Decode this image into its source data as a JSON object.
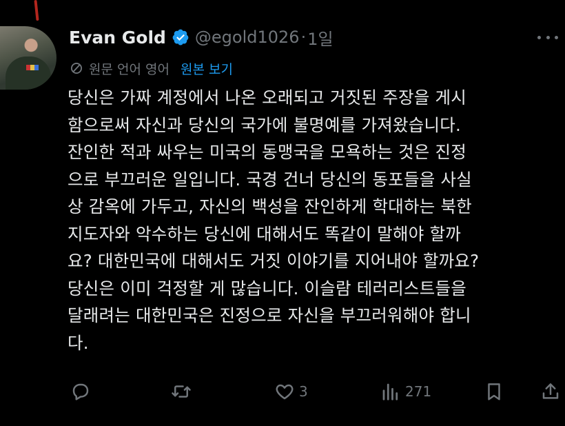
{
  "tweet": {
    "author_name": "Evan Gold",
    "handle": "@egold1026",
    "separator": "·",
    "time": "1일",
    "translated_from": "원문 언어 영어",
    "show_original": "원본 보기",
    "body_lines": [
      "당신은 가짜 계정에서 나온 오래되고 거짓된 주장을 게시",
      "함으로써 자신과 당신의 국가에 불명예를 가져왔습니다.",
      "잔인한 적과 싸우는 미국의 동맹국을 모욕하는 것은 진정",
      "으로 부끄러운 일입니다. 국경 건너 당신의 동포들을 사실",
      "상 감옥에 가두고, 자신의 백성을 잔인하게 학대하는 북한",
      "지도자와 악수하는 당신에 대해서도 똑같이 말해야 할까",
      "요? 대한민국에 대해서도 거짓 이야기를 지어내야 할까요?",
      "당신은 이미 걱정할 게 많습니다. 이슬람 테러리스트들을",
      "달래려는 대한민국은 진정으로 자신을 부끄러워해야 합니",
      "다."
    ]
  },
  "actions": {
    "reply": {
      "icon": "reply-icon",
      "count": ""
    },
    "repost": {
      "icon": "repost-icon",
      "count": ""
    },
    "like": {
      "icon": "heart-icon",
      "count": "3"
    },
    "views": {
      "icon": "views-icon",
      "count": "271"
    },
    "bookmark": {
      "icon": "bookmark-icon"
    },
    "share": {
      "icon": "share-icon"
    }
  },
  "colors": {
    "background": "#000000",
    "text": "#e7e9ea",
    "muted": "#71767b",
    "link": "#1d9bf0",
    "verified": "#1d9bf0"
  }
}
